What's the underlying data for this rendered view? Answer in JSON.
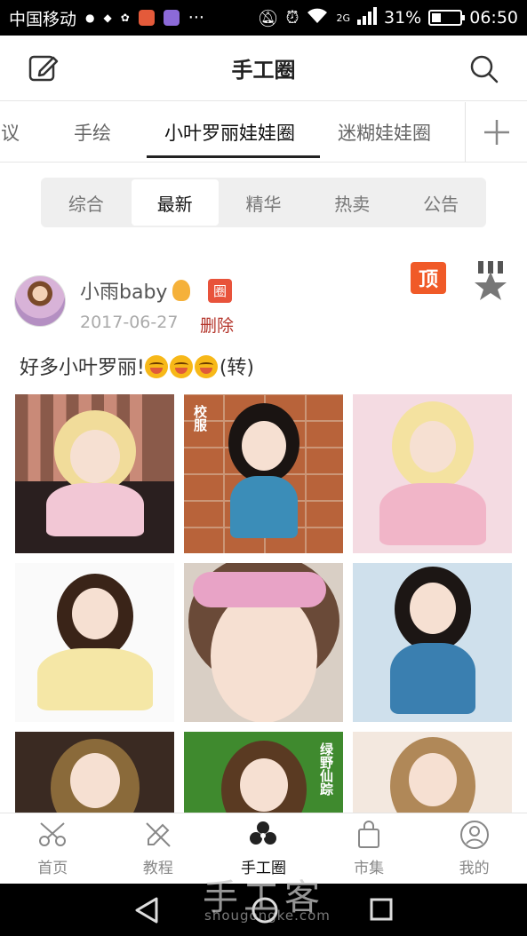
{
  "status_bar": {
    "carrier": "中国移动",
    "network": "2G",
    "battery_text": "31%",
    "battery_level": 0.31,
    "time": "06:50"
  },
  "header": {
    "title": "手工圈",
    "edit_icon": "edit-icon",
    "search_icon": "search-icon"
  },
  "circle_tabs": [
    {
      "label": "建议"
    },
    {
      "label": "手绘"
    },
    {
      "label": "小叶罗丽娃娃圈",
      "active": true
    },
    {
      "label": "迷糊娃娃圈"
    }
  ],
  "filter_tabs": [
    {
      "label": "综合"
    },
    {
      "label": "最新",
      "active": true
    },
    {
      "label": "精华"
    },
    {
      "label": "热卖"
    },
    {
      "label": "公告"
    }
  ],
  "post": {
    "author": "小雨baby",
    "circle_badge": "圈",
    "date": "2017-06-27",
    "delete_label": "删除",
    "pin_label": "顶",
    "text_before": "好多小叶罗丽!",
    "text_after": "(转)",
    "emoji_count": 3,
    "photo_captions": [
      "",
      "校服",
      "",
      "",
      "",
      "",
      "",
      "绿野仙踪",
      ""
    ]
  },
  "bottom_nav": [
    {
      "label": "首页",
      "icon": "scissors-icon"
    },
    {
      "label": "教程",
      "icon": "tutorial-icon"
    },
    {
      "label": "手工圈",
      "icon": "circle-flower-icon",
      "active": true
    },
    {
      "label": "市集",
      "icon": "shopping-bag-icon"
    },
    {
      "label": "我的",
      "icon": "user-icon"
    }
  ],
  "watermark": {
    "main": "手工客",
    "sub": "shougongke.com"
  },
  "colors": {
    "accent_red": "#e8533b",
    "pin_orange": "#f05a28",
    "delete_red": "#b4342a"
  }
}
